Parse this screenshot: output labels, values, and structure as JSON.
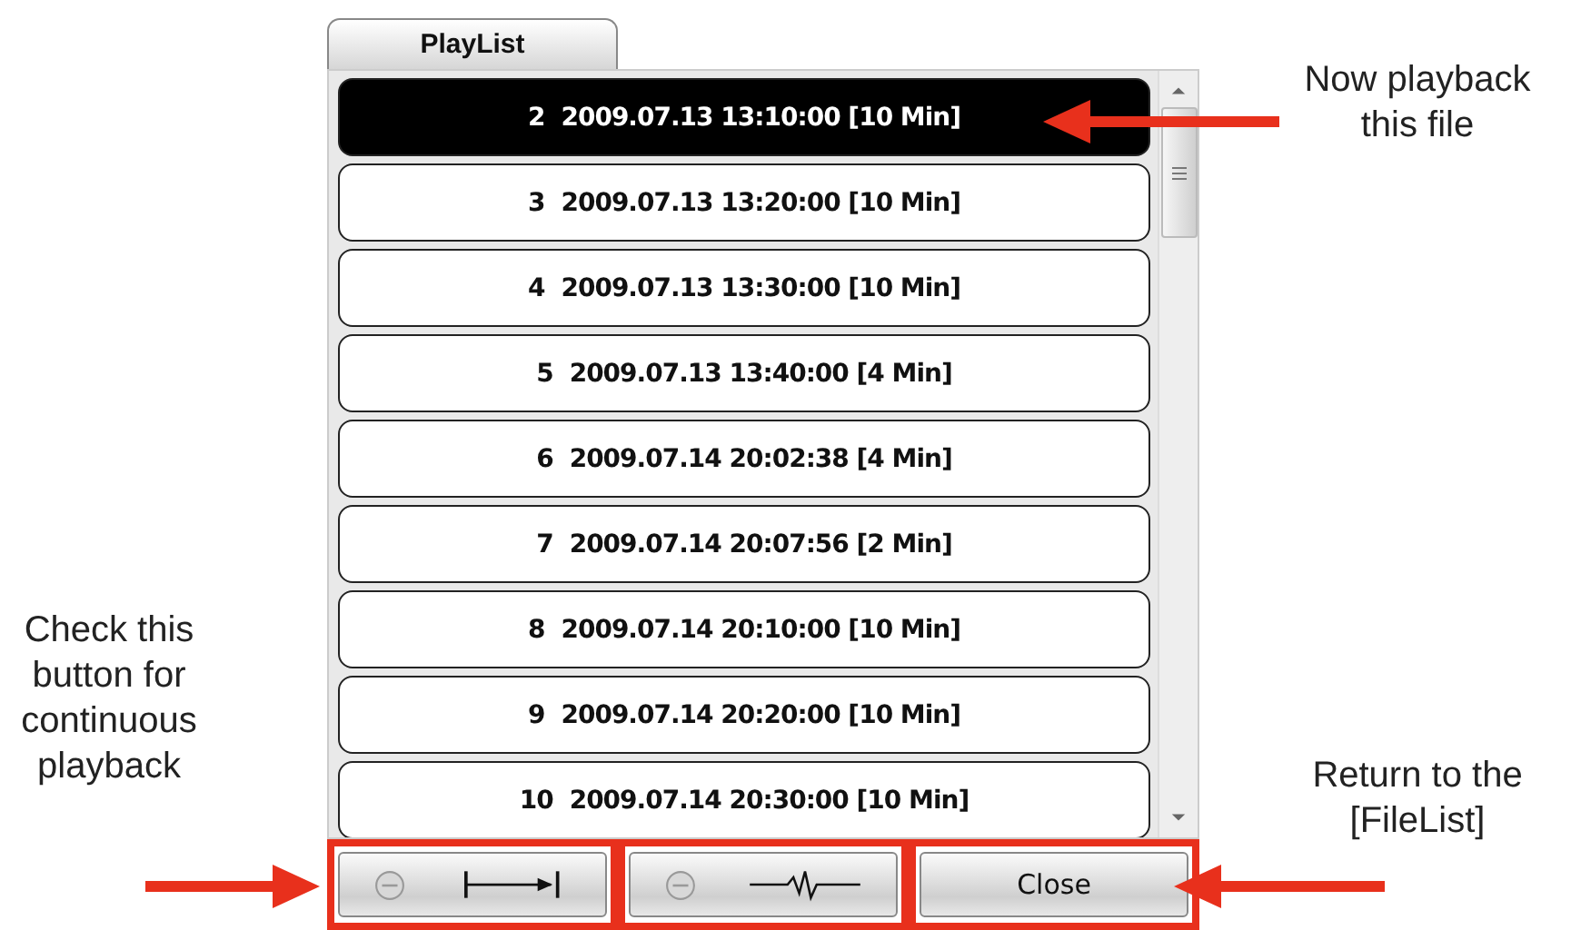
{
  "tab": {
    "label": "PlayList",
    "selected": true
  },
  "playlist": [
    {
      "number": "2",
      "text": "2009.07.13 13:10:00 [10 Min]",
      "selected": true
    },
    {
      "number": "3",
      "text": "2009.07.13 13:20:00 [10 Min]",
      "selected": false
    },
    {
      "number": "4",
      "text": "2009.07.13 13:30:00 [10 Min]",
      "selected": false
    },
    {
      "number": "5",
      "text": "2009.07.13 13:40:00 [4 Min]",
      "selected": false
    },
    {
      "number": "6",
      "text": "2009.07.14 20:02:38 [4 Min]",
      "selected": false
    },
    {
      "number": "7",
      "text": "2009.07.14 20:07:56 [2 Min]",
      "selected": false
    },
    {
      "number": "8",
      "text": "2009.07.14 20:10:00 [10 Min]",
      "selected": false
    },
    {
      "number": "9",
      "text": "2009.07.14 20:20:00 [10 Min]",
      "selected": false
    },
    {
      "number": "10",
      "text": "2009.07.14 20:30:00 [10 Min]",
      "selected": false
    }
  ],
  "buttons": [
    {
      "kind": "continuous",
      "checked": false
    },
    {
      "kind": "wave",
      "checked": false
    },
    {
      "kind": "text",
      "label": "Close"
    }
  ],
  "annotations": {
    "now_playing": "Now playback this file",
    "continuous": "Check this button for continuous playback",
    "close": "Return to the [FileList]"
  }
}
